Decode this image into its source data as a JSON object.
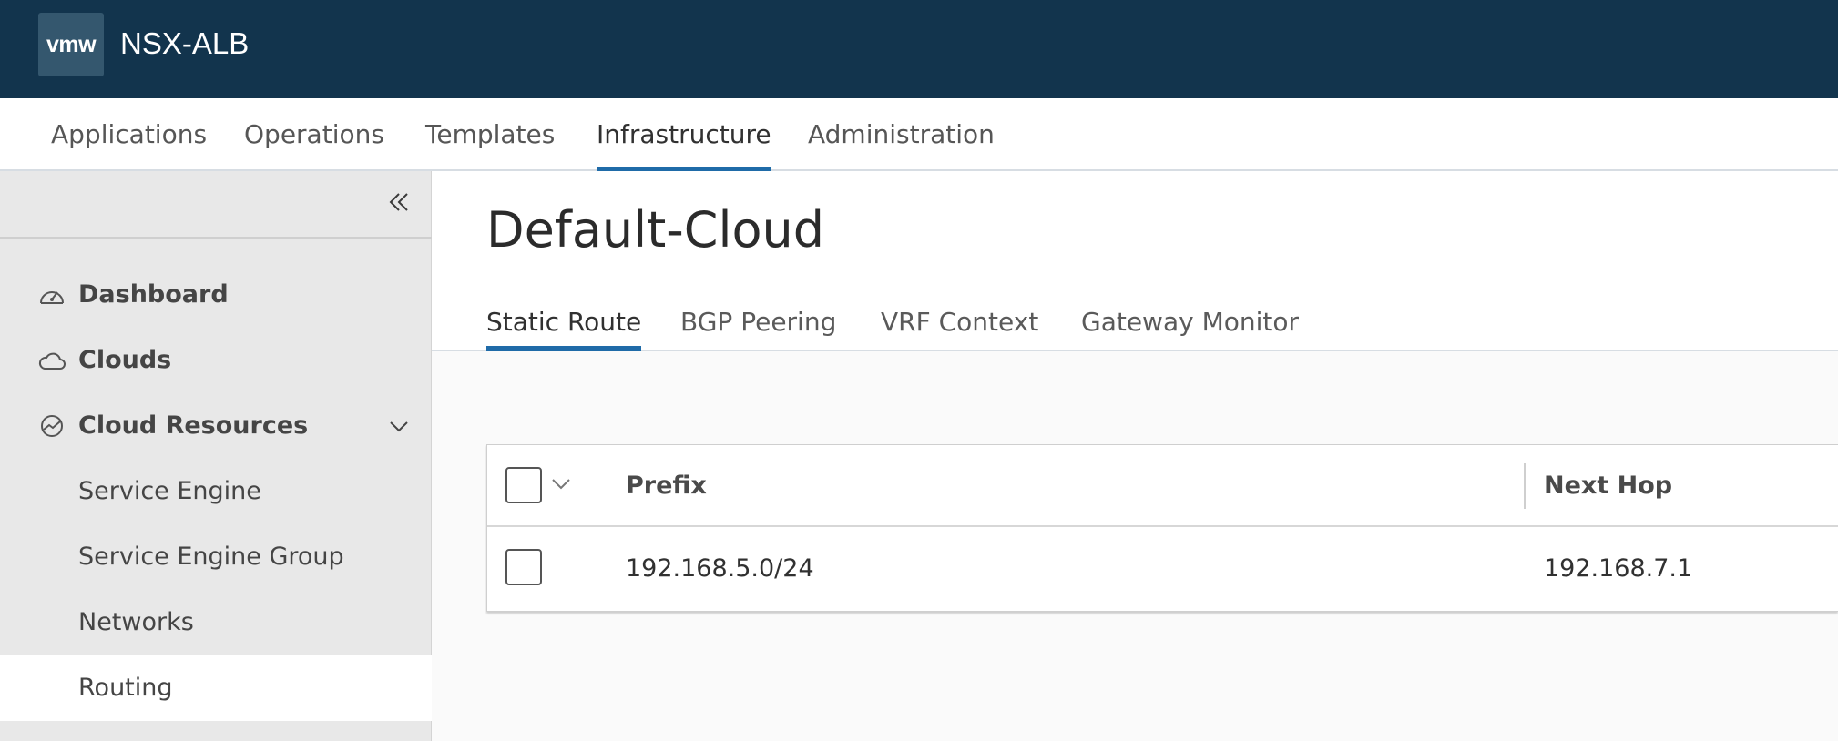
{
  "header": {
    "logo_text": "vmw",
    "app_title": "NSX-ALB",
    "background_color": "#12344d"
  },
  "main_nav": {
    "tabs": [
      {
        "label": "Applications"
      },
      {
        "label": "Operations"
      },
      {
        "label": "Templates"
      },
      {
        "label": "Infrastructure",
        "active": true
      },
      {
        "label": "Administration"
      }
    ],
    "accent_color": "#1f6ba8"
  },
  "sidebar": {
    "collapse_icon": "double-chevron-left-icon",
    "items": [
      {
        "label": "Dashboard",
        "icon": "dashboard-gauge-icon"
      },
      {
        "label": "Clouds",
        "icon": "cloud-icon"
      },
      {
        "label": "Cloud Resources",
        "icon": "cloud-resources-icon",
        "expanded": true
      },
      {
        "label": "Service Engine"
      },
      {
        "label": "Service Engine Group"
      },
      {
        "label": "Networks"
      },
      {
        "label": "Routing",
        "active": true
      }
    ]
  },
  "content": {
    "page_title": "Default-Cloud",
    "sub_tabs": [
      {
        "label": "Static Route",
        "active": true
      },
      {
        "label": "BGP Peering"
      },
      {
        "label": "VRF Context"
      },
      {
        "label": "Gateway Monitor"
      }
    ],
    "table": {
      "columns": [
        "Prefix",
        "Next Hop"
      ],
      "rows": [
        {
          "prefix": "192.168.5.0/24",
          "next_hop": "192.168.7.1"
        }
      ]
    }
  }
}
